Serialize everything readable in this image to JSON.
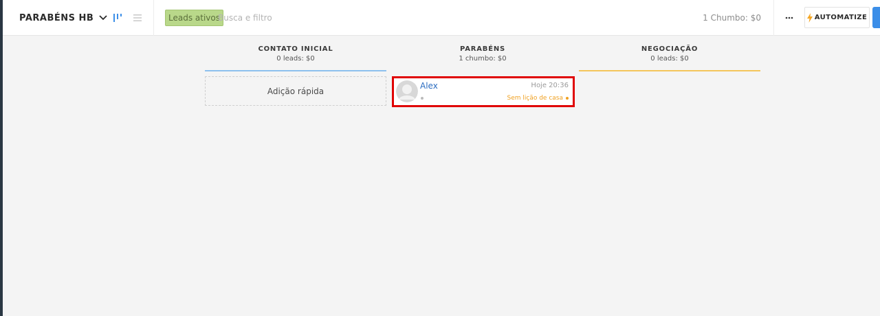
{
  "header": {
    "pipeline_name": "PARABÉNS HB",
    "filter_tag": "Leads ativos",
    "search_placeholder": "Busca e filtro",
    "summary": "1 Chumbo: $0",
    "more_label": "···",
    "automatize_label": "AUTOMATIZE"
  },
  "columns": [
    {
      "title": "CONTATO INICIAL",
      "count": "0 leads: $0",
      "color": "#8cc0ee"
    },
    {
      "title": "PARABÉNS",
      "count": "1 chumbo: $0",
      "color": "#f4f4f4"
    },
    {
      "title": "NEGOCIAÇÃO",
      "count": "0 leads: $0",
      "color": "#f4c55a"
    }
  ],
  "quick_add_label": "Adição rápida",
  "lead": {
    "name": "Alex",
    "time": "Hoje 20:36",
    "task_status": "Sem lição de casa"
  },
  "colors": {
    "accent_blue": "#3b8ee8",
    "lead_link": "#2a6cc0",
    "task_warning": "#f0a020",
    "highlight_border": "#e00000"
  },
  "icons": [
    "chevron-down-icon",
    "kanban-view-icon",
    "list-view-icon",
    "more-icon",
    "lightning-icon",
    "avatar-placeholder-icon"
  ]
}
